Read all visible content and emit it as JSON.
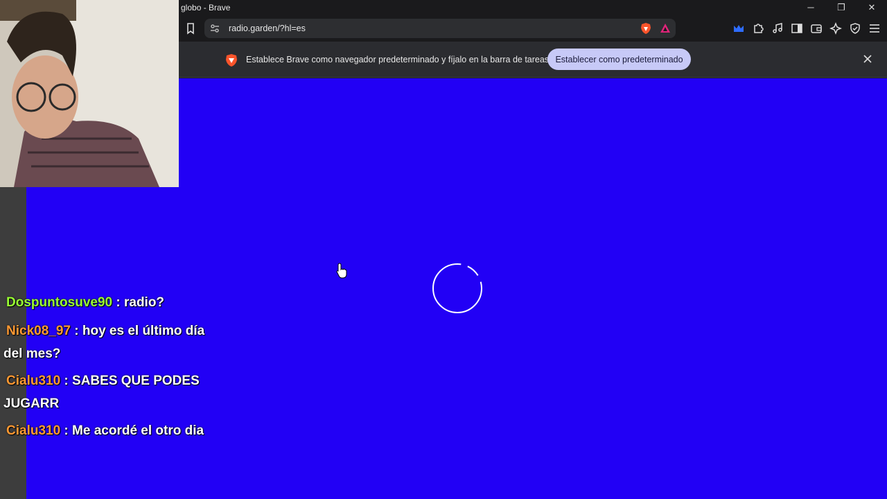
{
  "window": {
    "title": "globo - Brave",
    "controls": {
      "minimize": "─",
      "maximize": "❐",
      "close": "✕"
    }
  },
  "toolbar": {
    "url": "radio.garden/?hl=es"
  },
  "infobar": {
    "message": "Establece Brave como navegador predeterminado y fíjalo en la barra de tareas",
    "button_label": "Establecer como predeterminado"
  },
  "colors": {
    "content_bg": "#2200f5",
    "user_green": "#99ff33",
    "user_orange": "#ff9933",
    "brave_orange": "#fb542b"
  },
  "icons": {
    "bookmark": "bookmark-icon",
    "site_settings": "site-settings-icon",
    "shields": "brave-shields-icon",
    "rewards": "brave-rewards-icon",
    "extensions": [
      "mask-extension-icon",
      "puzzle-extensions-icon",
      "music-icon",
      "sidebar-icon",
      "wallet-icon",
      "leo-ai-icon",
      "vpn-shield-icon",
      "menu-icon"
    ],
    "loading": "loading-spinner-icon",
    "cursor": "hand-cursor-icon"
  },
  "chat": {
    "messages": [
      {
        "user": "Dospuntosuve90",
        "color": "#99ff33",
        "text": " : radio?"
      },
      {
        "user": "Nick08_97",
        "color": "#ff9933",
        "text": " : hoy es el último día del mes?"
      },
      {
        "user": "Cialu310",
        "color": "#ff9933",
        "text": " : SABES QUE PODES JUGARR"
      },
      {
        "user": "Cialu310",
        "color": "#ff9933",
        "text": " : Me acordé el otro dia"
      }
    ]
  }
}
